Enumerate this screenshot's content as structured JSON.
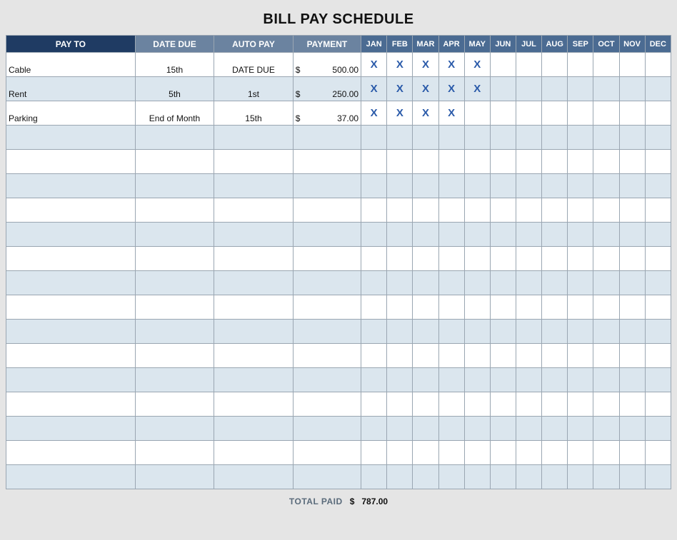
{
  "title": "BILL PAY SCHEDULE",
  "headers": {
    "payto": "PAY TO",
    "datedue": "DATE DUE",
    "autopay": "AUTO PAY",
    "payment": "PAYMENT"
  },
  "months": [
    "JAN",
    "FEB",
    "MAR",
    "APR",
    "MAY",
    "JUN",
    "JUL",
    "AUG",
    "SEP",
    "OCT",
    "NOV",
    "DEC"
  ],
  "currency_symbol": "$",
  "total_rows": 18,
  "rows": [
    {
      "payto": "Cable",
      "datedue": "15th",
      "autopay": "DATE DUE",
      "payment": "500.00",
      "months": [
        "X",
        "X",
        "X",
        "X",
        "X",
        "",
        "",
        "",
        "",
        "",
        "",
        ""
      ]
    },
    {
      "payto": "Rent",
      "datedue": "5th",
      "autopay": "1st",
      "payment": "250.00",
      "months": [
        "X",
        "X",
        "X",
        "X",
        "X",
        "",
        "",
        "",
        "",
        "",
        "",
        ""
      ]
    },
    {
      "payto": "Parking",
      "datedue": "End of Month",
      "autopay": "15th",
      "payment": "37.00",
      "months": [
        "X",
        "X",
        "X",
        "X",
        "",
        "",
        "",
        "",
        "",
        "",
        "",
        ""
      ]
    }
  ],
  "footer": {
    "label": "TOTAL PAID",
    "currency": "$",
    "amount": "787.00"
  }
}
